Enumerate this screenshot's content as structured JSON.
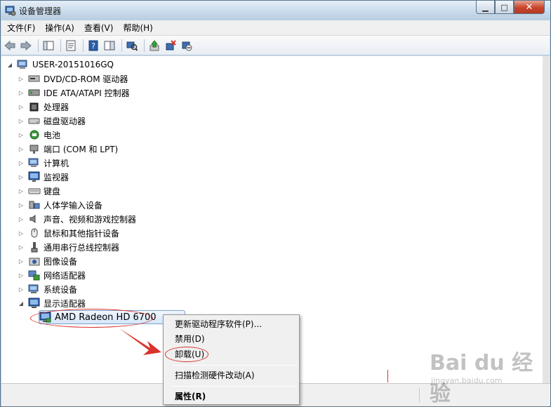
{
  "window": {
    "title": "设备管理器",
    "minimize_glyph": "▁",
    "maximize_glyph": "□",
    "close_glyph": "✕"
  },
  "menubar": {
    "items": [
      "文件(F)",
      "操作(A)",
      "查看(V)",
      "帮助(H)"
    ]
  },
  "toolbar": {
    "icons": [
      "back-arrow-icon",
      "forward-arrow-icon",
      "show-hide-tree-icon",
      "properties-icon",
      "help-icon",
      "action-pane-icon",
      "scan-hardware-icon",
      "update-driver-icon",
      "uninstall-icon",
      "disable-device-icon"
    ]
  },
  "tree": {
    "root": {
      "label": "USER-20151016GQ",
      "icon": "computer-icon",
      "expander": "◢"
    },
    "categories": [
      {
        "label": "DVD/CD-ROM 驱动器",
        "icon": "dvd-drive-icon"
      },
      {
        "label": "IDE ATA/ATAPI 控制器",
        "icon": "ide-controller-icon"
      },
      {
        "label": "处理器",
        "icon": "processor-icon"
      },
      {
        "label": "磁盘驱动器",
        "icon": "disk-drive-icon"
      },
      {
        "label": "电池",
        "icon": "battery-icon"
      },
      {
        "label": "端口 (COM 和 LPT)",
        "icon": "port-icon"
      },
      {
        "label": "计算机",
        "icon": "computer-icon"
      },
      {
        "label": "监视器",
        "icon": "monitor-icon"
      },
      {
        "label": "键盘",
        "icon": "keyboard-icon"
      },
      {
        "label": "人体学输入设备",
        "icon": "hid-icon"
      },
      {
        "label": "声音、视频和游戏控制器",
        "icon": "sound-icon"
      },
      {
        "label": "鼠标和其他指针设备",
        "icon": "mouse-icon"
      },
      {
        "label": "通用串行总线控制器",
        "icon": "usb-icon"
      },
      {
        "label": "图像设备",
        "icon": "imaging-device-icon"
      },
      {
        "label": "网络适配器",
        "icon": "network-adapter-icon"
      },
      {
        "label": "系统设备",
        "icon": "system-device-icon"
      },
      {
        "label": "显示适配器",
        "icon": "display-adapter-icon"
      }
    ],
    "expander_collapsed": "▷",
    "expander_expanded": "◢",
    "selected_child": {
      "label": "AMD Radeon HD 6700",
      "icon": "display-adapter-icon"
    }
  },
  "context_menu": {
    "items": [
      {
        "label": "更新驱动程序软件(P)...",
        "bold": false
      },
      {
        "label": "禁用(D)",
        "bold": false
      },
      {
        "label": "卸载(U)",
        "bold": false
      },
      {
        "label": "扫描检测硬件改动(A)",
        "bold": false
      },
      {
        "label": "属性(R)",
        "bold": true
      }
    ]
  },
  "watermark": {
    "main": "Bai du 经验",
    "sub": "jingyan.baidu.com"
  },
  "colors": {
    "annotation": "#d9332b",
    "selection_border": "#7da2ce",
    "icon_blue": "#2a5ea8"
  }
}
